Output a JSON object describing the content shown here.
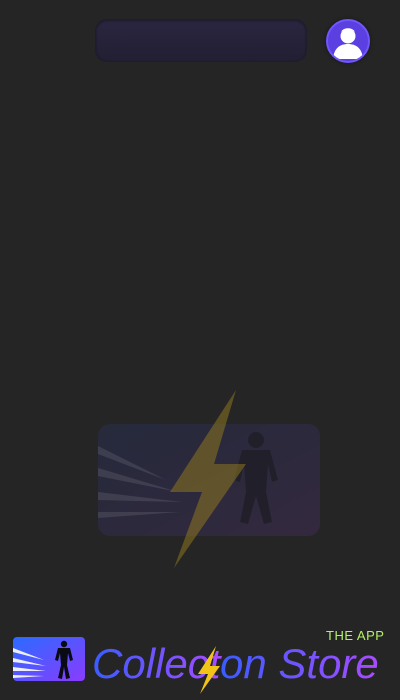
{
  "header": {
    "search_bar": {
      "placeholder": ""
    },
    "avatar_icon": "user-avatar-icon"
  },
  "loader": {
    "icon": "lightning-hero-logo-icon"
  },
  "footer": {
    "brand_part1": "Collect",
    "brand_part2": "on Store",
    "tagline": "THE APP",
    "logo_icon": "hero-silhouette-logo-icon"
  },
  "colors": {
    "background": "#252525",
    "accent_purple": "#5b3fe0",
    "brand_gradient_start": "#3a5cff",
    "brand_gradient_end": "#a84cff",
    "bolt_yellow": "#f2c417",
    "tagline_green": "#b6f06a"
  }
}
